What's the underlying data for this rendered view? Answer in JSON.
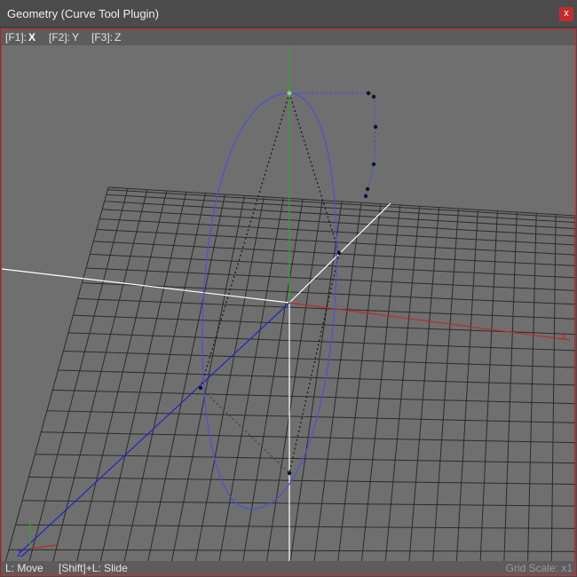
{
  "window": {
    "title": "Geometry (Curve Tool Plugin)",
    "close_label": "x"
  },
  "axis_bar": {
    "options": [
      {
        "key": "[F1]:",
        "value": "X",
        "active": true
      },
      {
        "key": "[F2]:",
        "value": "Y",
        "active": false
      },
      {
        "key": "[F3]:",
        "value": "Z",
        "active": false
      }
    ]
  },
  "viewport": {
    "x_axis_label": "X",
    "z_gizmo_label": "Z",
    "colors": {
      "background": "#6f6f6f",
      "grid": "#2b2b2b",
      "x_axis": "#c0282a",
      "y_axis": "#2fa82f",
      "z_axis": "#2424c8",
      "curve": "#4f4fd6",
      "border_active": "#d42a2a"
    }
  },
  "status": {
    "move_hint": "L: Move",
    "slide_hint": "[Shift]+L: Slide",
    "grid_scale": "Grid Scale: x1"
  }
}
